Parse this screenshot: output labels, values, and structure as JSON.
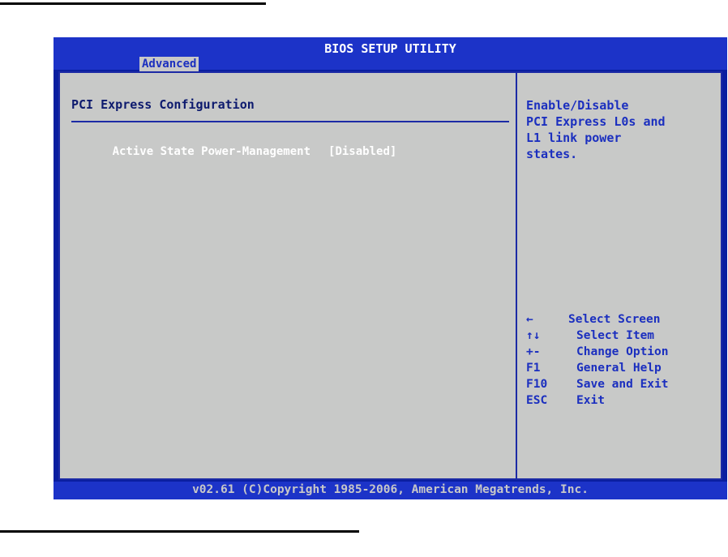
{
  "header": {
    "title": "BIOS SETUP UTILITY",
    "active_tab": "Advanced"
  },
  "main": {
    "section_title": "PCI Express Configuration",
    "settings": [
      {
        "label": "Active State Power-Management",
        "value": "[Disabled]"
      }
    ]
  },
  "help": {
    "lines": [
      "Enable/Disable",
      "PCI Express L0s and",
      "L1 link power",
      "states."
    ]
  },
  "keys": [
    {
      "key": "←",
      "desc": "Select Screen"
    },
    {
      "key": "↑↓",
      "desc": "Select Item"
    },
    {
      "key": "+-",
      "desc": "Change Option"
    },
    {
      "key": "F1",
      "desc": "General Help"
    },
    {
      "key": "F10",
      "desc": "Save and Exit"
    },
    {
      "key": "ESC",
      "desc": "Exit"
    }
  ],
  "footer": {
    "copyright": "v02.61 (C)Copyright 1985-2006, American Megatrends, Inc."
  },
  "colors": {
    "frame_blue": "#1c33c8",
    "panel_gray": "#c8c9c8",
    "help_text_blue": "#1b2fbf",
    "selected_text": "#ffffff"
  }
}
